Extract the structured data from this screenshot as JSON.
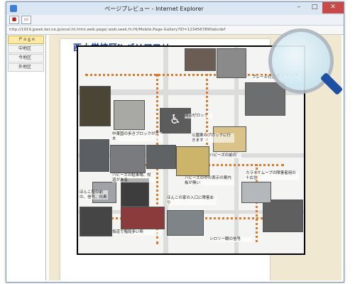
{
  "window": {
    "title": "ページプレビュー - Internet Explorer",
    "controls": {
      "minimize": "–",
      "maximize": "□",
      "close": "✕"
    }
  },
  "address": {
    "url": "http://1919.jpeek.kei.ne.jp/eval.ht.html.web.page/.web.seek.fn:Hi/Mobile.Page-Gallery?ID=1234567890abcdef"
  },
  "sidebar": {
    "items": [
      {
        "label": "Ｐａｇｅ"
      },
      {
        "label": "中地区"
      },
      {
        "label": "今地区"
      },
      {
        "label": "外地区"
      }
    ]
  },
  "map": {
    "title": "西小学校区",
    "title_suffix": "バリアフリー",
    "title_superscript": "Bf",
    "labels": [
      "プレール付きの",
      "中東国の歩きブロックが荒木",
      "公園東のブロックに行きます",
      "岡山ゼロック",
      "ハビーズの前の",
      "カラオケムーブの障害者用の十広位",
      "ハビーズの駐車場、杖道がある",
      "ハビーズの中の表示の案内板が無い",
      "ほんこ屋の前の、信号、白黒",
      "ほんこの家の入口に障害あり",
      "坂道で階段多い所",
      "シロリー観の信号"
    ]
  },
  "colors": {
    "route": "#e07a2a",
    "title": "#1a3ca8",
    "frame": "#000000",
    "magnifier_handle": "#1d4fa5"
  }
}
